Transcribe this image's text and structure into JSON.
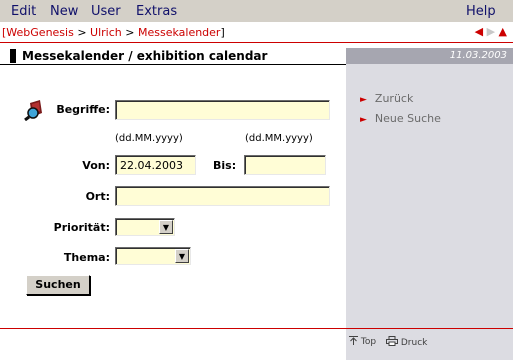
{
  "menu": {
    "items": [
      "Edit",
      "New",
      "User",
      "Extras"
    ],
    "help": "Help"
  },
  "breadcrumb": {
    "open_bracket": "[",
    "items": [
      "WebGenesis",
      "Ulrich",
      "Messekalender"
    ],
    "separator": ">",
    "close_bracket": "]"
  },
  "nav": {
    "back_arrow": "◀",
    "forward_arrow": "▶",
    "up_arrow": "▲"
  },
  "title": {
    "text": "Messekalender / exhibition calendar",
    "date": "11.03.2003"
  },
  "sidebar": {
    "bullet": "►",
    "links": [
      "Zurück",
      "Neue Suche"
    ]
  },
  "form": {
    "begriffe_label": "Begriffe:",
    "begriffe_value": "",
    "date_hint_von": "(dd.MM.yyyy)",
    "date_hint_bis": "(dd.MM.yyyy)",
    "von_label": "Von:",
    "von_value": "22.04.2003",
    "bis_label": "Bis:",
    "bis_value": "",
    "ort_label": "Ort:",
    "ort_value": "",
    "prioritaet_label": "Priorität:",
    "prioritaet_value": "",
    "thema_label": "Thema:",
    "thema_value": "",
    "search_label": "Suchen"
  },
  "footer": {
    "top_label": "Top",
    "print_label": "Druck"
  },
  "colors": {
    "accent_red": "#cc0000",
    "input_bg": "#fffdd6",
    "panel_bg": "#dcdce2",
    "menubar_bg": "#d4d0c8"
  }
}
